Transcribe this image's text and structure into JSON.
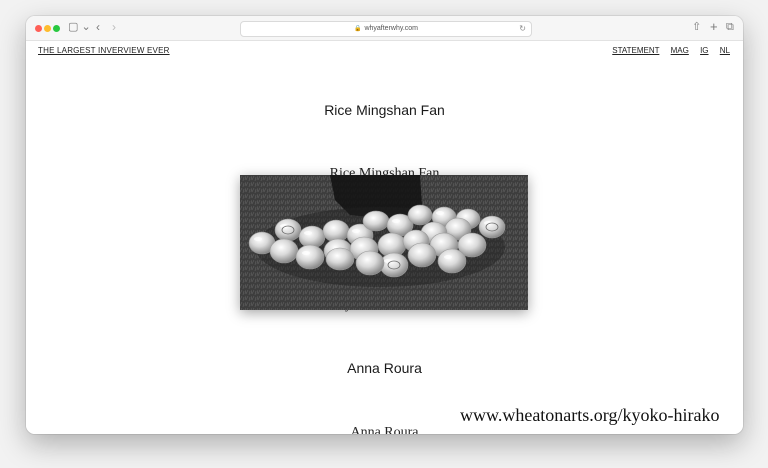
{
  "browser": {
    "url": "whyafterwhy.com",
    "icons": {
      "sidebar": "sidebar-icon",
      "back": "chevron-left-icon",
      "forward": "chevron-right-icon",
      "share": "share-icon",
      "new_tab": "plus-icon",
      "tabs": "tabs-icon",
      "lock": "lock-icon",
      "reload": "reload-icon"
    }
  },
  "site": {
    "title": "THE LARGEST INVERVIEW EVER",
    "nav": [
      "STATEMENT",
      "MAG",
      "IG",
      "NL"
    ]
  },
  "entries": [
    {
      "text": "Rice Mingshan Fan"
    },
    {
      "text": "Rice Mingshan Fan"
    },
    {
      "text": "Anna Roura"
    },
    {
      "text": "Anna Roura"
    }
  ],
  "hover_image": {
    "subject": "black-and-white photo of translucent glass domes arranged on grass"
  },
  "watermark": "www.wheatonarts.org/kyoko-hirako",
  "colors": {
    "background": "#ffffff",
    "text": "#1a1a1a",
    "traffic_red": "#ff5f57",
    "traffic_yellow": "#febc2e",
    "traffic_green": "#28c840"
  }
}
